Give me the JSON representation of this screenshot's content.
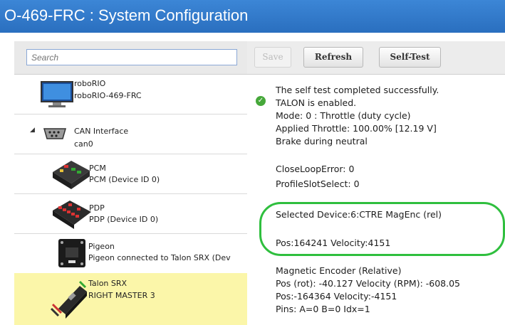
{
  "window": {
    "title": "O-469-FRC : System Configuration"
  },
  "search": {
    "placeholder": "Search"
  },
  "toolbar": {
    "save_label": "Save",
    "refresh_label": "Refresh",
    "selftest_label": "Self-Test"
  },
  "tree": [
    {
      "name": "roboRIO",
      "sub": "roboRIO-469-FRC",
      "icon": "monitor-icon"
    },
    {
      "name": "CAN Interface",
      "sub": "can0",
      "icon": "can-connector-icon",
      "expander": "◢"
    },
    {
      "name": "PCM",
      "sub": "PCM (Device ID 0)",
      "icon": "pcm-module-icon"
    },
    {
      "name": "PDP",
      "sub": "PDP (Device ID 0)",
      "icon": "pdp-module-icon"
    },
    {
      "name": "Pigeon",
      "sub": "Pigeon connected to Talon SRX (Dev",
      "icon": "pigeon-imu-icon"
    },
    {
      "name": "Talon SRX",
      "sub": "RIGHT MASTER 3",
      "icon": "talon-srx-icon",
      "selected": true
    }
  ],
  "details": {
    "status": "success",
    "lines": [
      "The self test completed successfully.",
      "TALON is enabled.",
      "Mode: 0 : Throttle (duty cycle)",
      "Applied Throttle:  100.00% [12.19 V]",
      "Brake during neutral",
      "CloseLoopError: 0",
      "ProfileSlotSelect: 0",
      "Selected Device:6:CTRE MagEnc (rel)",
      "Pos:164241   Velocity:4151",
      "Magnetic Encoder (Relative)",
      "Pos (rot):  -40.127 Velocity (RPM): -608.05",
      "Pos:-164364  Velocity:-4151",
      "Pins: A=0 B=0 Idx=1"
    ]
  },
  "colors": {
    "title_bar": "#2a6fbf",
    "selected_row": "#fbf6a9",
    "highlight_ring": "#2fbf3e",
    "success": "#46a83a"
  }
}
